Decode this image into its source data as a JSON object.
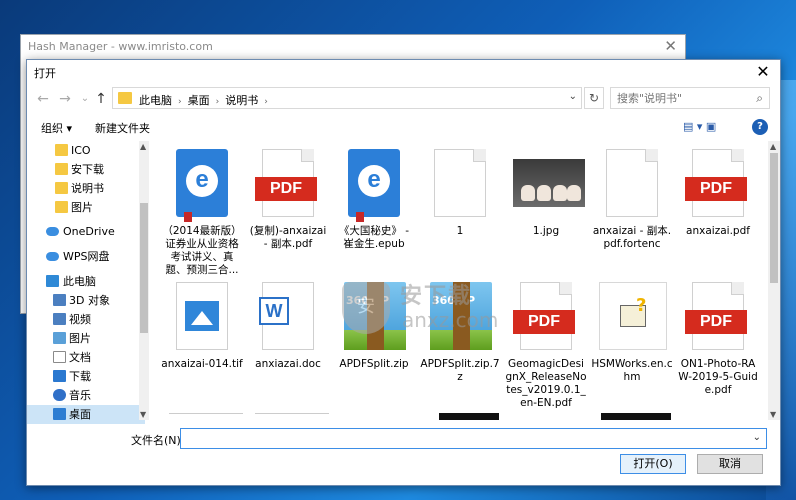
{
  "background_window": {
    "title": "Hash Manager - www.imristo.com",
    "close_glyph": "✕"
  },
  "dialog": {
    "title": "打开",
    "close_glyph": "✕",
    "nav": {
      "back": "←",
      "forward": "→",
      "recent": "⌄",
      "up": "↑"
    },
    "address": {
      "crumbs": [
        "此电脑",
        "桌面",
        "说明书"
      ],
      "separator": "›"
    },
    "search": {
      "placeholder": "搜索\"说明书\""
    },
    "toolbar": {
      "organize": "组织 ▾",
      "new_folder": "新建文件夹",
      "view_icons": "▤ ▾   ▣",
      "help": "?"
    },
    "sidebar": {
      "items": [
        {
          "label": "ICO",
          "icon": "folder-icon"
        },
        {
          "label": "安下载",
          "icon": "folder-icon"
        },
        {
          "label": "说明书",
          "icon": "folder-icon"
        },
        {
          "label": "图片",
          "icon": "folder-icon"
        },
        {
          "label": "OneDrive",
          "icon": "onedrive-icon"
        },
        {
          "label": "WPS网盘",
          "icon": "cloud-icon"
        },
        {
          "label": "此电脑",
          "icon": "computer-icon"
        },
        {
          "label": "3D 对象",
          "icon": "3d-objects-icon"
        },
        {
          "label": "视频",
          "icon": "video-icon"
        },
        {
          "label": "图片",
          "icon": "pictures-icon"
        },
        {
          "label": "文档",
          "icon": "documents-icon"
        },
        {
          "label": "下载",
          "icon": "downloads-icon"
        },
        {
          "label": "音乐",
          "icon": "music-icon"
        },
        {
          "label": "桌面",
          "icon": "desktop-icon"
        }
      ]
    },
    "files": [
      {
        "label": "（2014最新版）证券业从业资格考试讲义、真题、预测三合...",
        "type": "ebook"
      },
      {
        "label": "(复制)-anxaizai - 副本.pdf",
        "type": "pdf"
      },
      {
        "label": "《大国秘史》 - 崔金生.epub",
        "type": "ebook"
      },
      {
        "label": "1",
        "type": "blank"
      },
      {
        "label": "1.jpg",
        "type": "photo"
      },
      {
        "label": "anxaizai - 副本.pdf.fortenc",
        "type": "blank"
      },
      {
        "label": "anxaizai.pdf",
        "type": "pdf"
      },
      {
        "label": "anxaizai-014.tif",
        "type": "tif"
      },
      {
        "label": "anxiazai.doc",
        "type": "word"
      },
      {
        "label": "APDFSplit.zip",
        "type": "zip"
      },
      {
        "label": "APDFSplit.zip.7z",
        "type": "zip"
      },
      {
        "label": "GeomagicDesignX_ReleaseNotes_v2019.0.1_en-EN.pdf",
        "type": "pdf"
      },
      {
        "label": "HSMWorks.en.chm",
        "type": "chm"
      },
      {
        "label": "ON1-Photo-RAW-2019-5-Guide.pdf",
        "type": "pdf"
      }
    ],
    "file_badges": {
      "pdf": "PDF",
      "ebook": "e",
      "word": "W",
      "zip": "360ZIP",
      "chm": "?"
    },
    "watermark": {
      "line1": "安下载",
      "line2": "anxz.com",
      "shield": "安"
    },
    "filename": {
      "label": "文件名(N):",
      "value": ""
    },
    "buttons": {
      "open": "打开(O)",
      "cancel": "取消"
    },
    "scroll_arrows": {
      "up": "▲",
      "down": "▼"
    }
  }
}
